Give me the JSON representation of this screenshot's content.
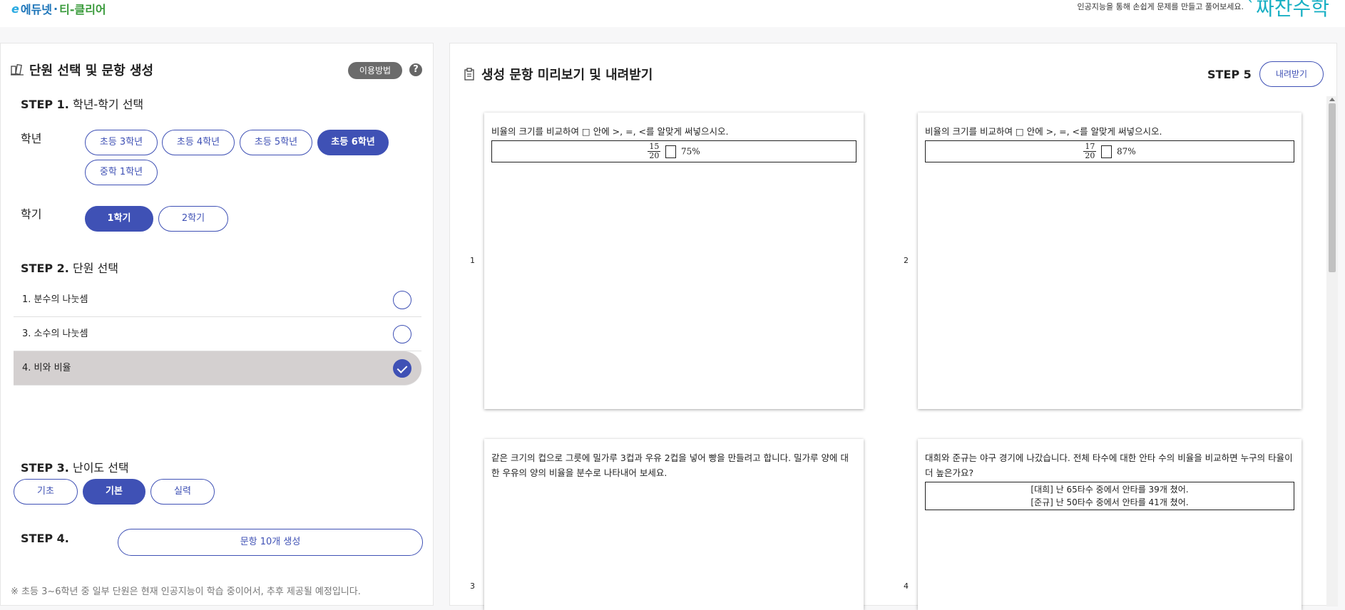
{
  "header": {
    "logo_e": "e",
    "logo_a": "에듀넷",
    "logo_sep": "·",
    "logo_b": "티-클리어",
    "description": "인공지능을 통해 손쉽게 문제를 만들고 풀어보세요.",
    "brand": "`짜잔수학"
  },
  "left": {
    "title": "단원 선택 및 문항 생성",
    "help_label": "이용방법",
    "help_q": "?",
    "step1": {
      "label": "STEP 1.",
      "text": "학년-학기 선택"
    },
    "grade_label": "학년",
    "grades": [
      "초등 3학년",
      "초등 4학년",
      "초등 5학년",
      "초등 6학년",
      "중학 1학년"
    ],
    "selected_grade": "초등 6학년",
    "semester_label": "학기",
    "semesters": [
      "1학기",
      "2학기"
    ],
    "selected_semester": "1학기",
    "step2": {
      "label": "STEP 2.",
      "text": "단원 선택"
    },
    "units": [
      "1. 분수의 나눗셈",
      "3. 소수의 나눗셈",
      "4. 비와 비율"
    ],
    "selected_unit": "4. 비와 비율",
    "step3": {
      "label": "STEP 3.",
      "text": "난이도 선택"
    },
    "levels": [
      "기초",
      "기본",
      "실력"
    ],
    "selected_level": "기본",
    "step4": {
      "label": "STEP 4."
    },
    "generate_button": "문항 10개 생성",
    "note": "※ 초등 3~6학년 중 일부 단원은 현재 인공지능이 학습 중이어서, 추후 제공될 예정입니다."
  },
  "right": {
    "title": "생성 문항 미리보기 및 내려받기",
    "step5": "STEP 5",
    "download_button": "내려받기",
    "questions": [
      {
        "num": "1",
        "text": "비율의 크기를 비교하여 □ 안에 >, =, <를 알맞게 써넣으시오.",
        "num_top": "15",
        "den": "20",
        "value": "75%"
      },
      {
        "num": "2",
        "text": "비율의 크기를 비교하여 □ 안에 >, =, <를 알맞게 써넣으시오.",
        "num_top": "17",
        "den": "20",
        "value": "87%"
      },
      {
        "num": "3",
        "text": "같은 크기의 컵으로 그릇에 밀가루 3컵과 우유 2컵을 넣어 빵을 만들려고 합니다. 밀가루 양에 대한 우유의 양의 비율을 분수로 나타내어 보세요."
      },
      {
        "num": "4",
        "text": "대희와 준규는 야구 경기에 나갔습니다. 전체 타수에 대한 안타 수의 비율을 비교하면 누구의 타율이 더 높은가요?",
        "line1": "[대희] 난 65타수 중에서 안타를 39개 쳤어.",
        "line2": "[준규] 난 50타수 중에서 안타를 41개 쳤어."
      }
    ]
  }
}
